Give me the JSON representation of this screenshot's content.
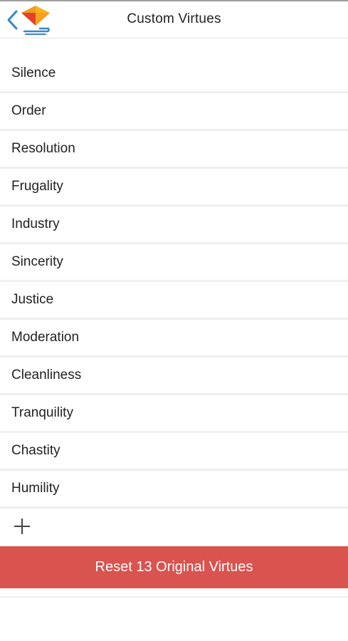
{
  "header": {
    "title": "Custom Virtues",
    "back_icon": "chevron-left-icon",
    "logo_icon": "diamond-logo-icon"
  },
  "virtues": [
    {
      "label": "Silence"
    },
    {
      "label": "Order"
    },
    {
      "label": "Resolution"
    },
    {
      "label": "Frugality"
    },
    {
      "label": "Industry"
    },
    {
      "label": "Sincerity"
    },
    {
      "label": "Justice"
    },
    {
      "label": "Moderation"
    },
    {
      "label": "Cleanliness"
    },
    {
      "label": "Tranquility"
    },
    {
      "label": "Chastity"
    },
    {
      "label": "Humility"
    }
  ],
  "add": {
    "icon": "plus-icon"
  },
  "reset_button": {
    "label": "Reset 13 Original Virtues"
  },
  "colors": {
    "accent_blue": "#3a86c8",
    "reset_red": "#d9534f",
    "logo_orange": "#f39a1f",
    "logo_red": "#e4432b"
  }
}
